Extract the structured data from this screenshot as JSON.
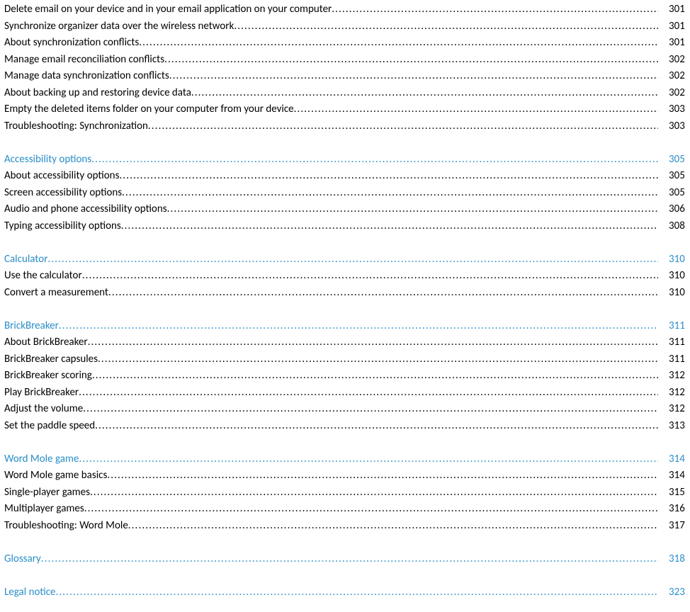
{
  "toc": [
    {
      "type": "item",
      "title": "Delete email on your device and in your email application on your computer",
      "page": "301"
    },
    {
      "type": "item",
      "title": "Synchronize organizer data over the wireless network",
      "page": "301"
    },
    {
      "type": "item",
      "title": "About synchronization conflicts",
      "page": "301"
    },
    {
      "type": "item",
      "title": "Manage email reconciliation conflicts",
      "page": "302"
    },
    {
      "type": "item",
      "title": "Manage data synchronization conflicts",
      "page": "302"
    },
    {
      "type": "item",
      "title": "About backing up and restoring device data",
      "page": "302"
    },
    {
      "type": "item",
      "title": "Empty the deleted items folder on your computer from your device",
      "page": "303"
    },
    {
      "type": "item",
      "title": "Troubleshooting: Synchronization",
      "page": "303"
    },
    {
      "type": "spacer"
    },
    {
      "type": "heading",
      "title": "Accessibility options",
      "page": "305"
    },
    {
      "type": "item",
      "title": "About accessibility options",
      "page": "305"
    },
    {
      "type": "item",
      "title": "Screen accessibility options",
      "page": "305"
    },
    {
      "type": "item",
      "title": "Audio and phone accessibility options",
      "page": "306"
    },
    {
      "type": "item",
      "title": "Typing accessibility options",
      "page": "308"
    },
    {
      "type": "spacer"
    },
    {
      "type": "heading",
      "title": "Calculator",
      "page": "310"
    },
    {
      "type": "item",
      "title": "Use the calculator",
      "page": "310"
    },
    {
      "type": "item",
      "title": "Convert a measurement",
      "page": "310"
    },
    {
      "type": "spacer"
    },
    {
      "type": "heading",
      "title": "BrickBreaker",
      "page": "311"
    },
    {
      "type": "item",
      "title": "About BrickBreaker",
      "page": "311"
    },
    {
      "type": "item",
      "title": "BrickBreaker capsules",
      "page": "311"
    },
    {
      "type": "item",
      "title": "BrickBreaker scoring",
      "page": "312"
    },
    {
      "type": "item",
      "title": "Play BrickBreaker",
      "page": "312"
    },
    {
      "type": "item",
      "title": "Adjust the volume",
      "page": "312"
    },
    {
      "type": "item",
      "title": "Set the paddle speed",
      "page": "313"
    },
    {
      "type": "spacer"
    },
    {
      "type": "heading",
      "title": "Word Mole game",
      "page": "314"
    },
    {
      "type": "item",
      "title": "Word Mole game basics",
      "page": "314"
    },
    {
      "type": "item",
      "title": "Single-player games",
      "page": "315"
    },
    {
      "type": "item",
      "title": "Multiplayer games",
      "page": "316"
    },
    {
      "type": "item",
      "title": "Troubleshooting: Word Mole",
      "page": "317"
    },
    {
      "type": "spacer"
    },
    {
      "type": "heading",
      "title": "Glossary",
      "page": "318"
    },
    {
      "type": "spacer"
    },
    {
      "type": "heading",
      "title": "Legal notice",
      "page": "323"
    }
  ]
}
